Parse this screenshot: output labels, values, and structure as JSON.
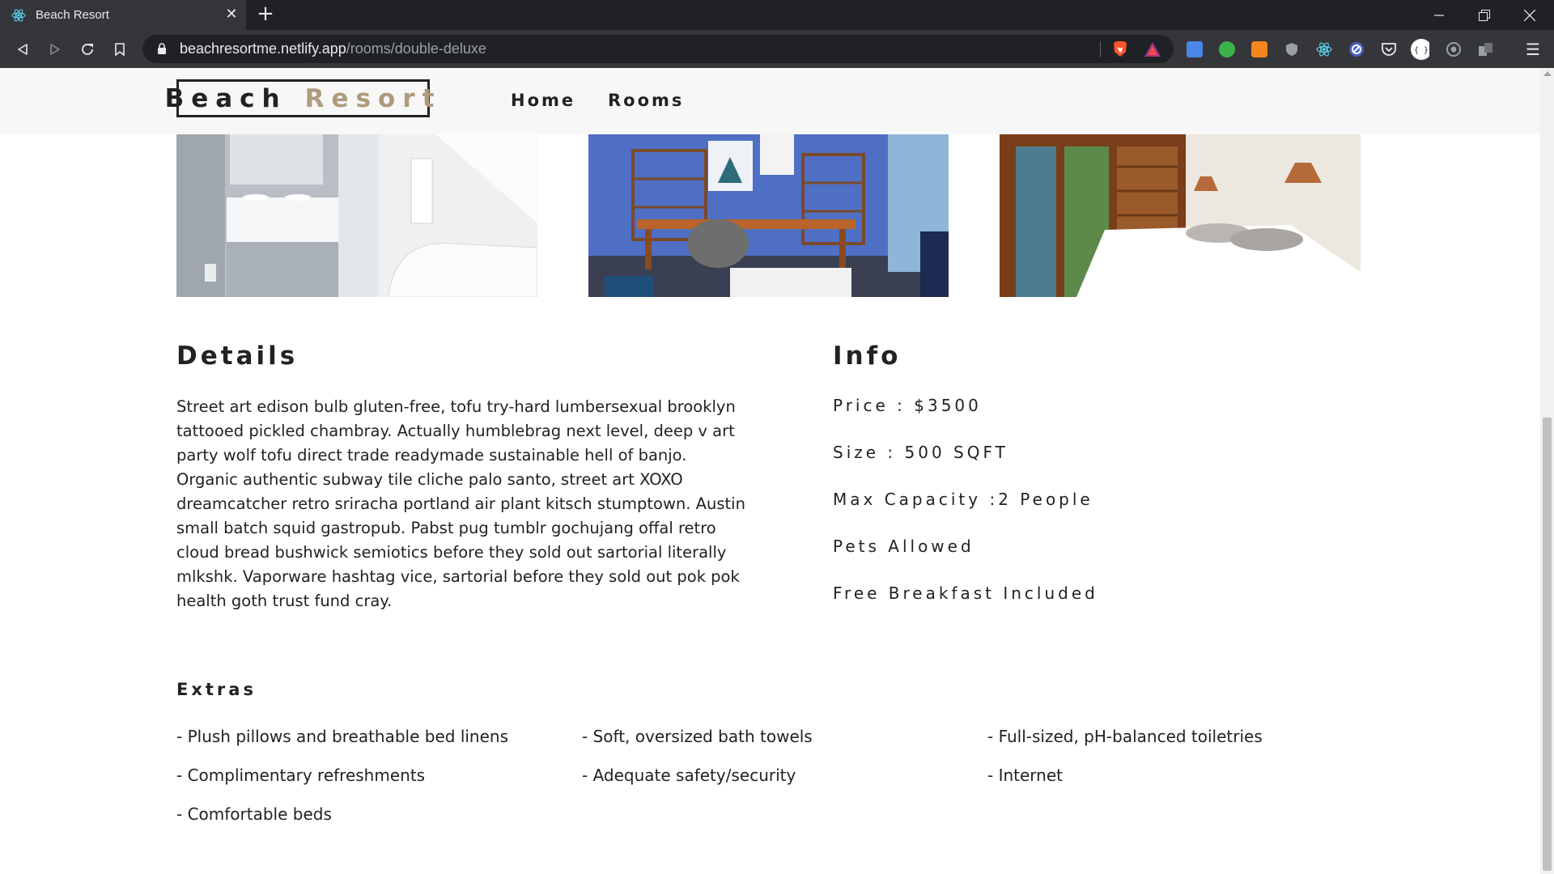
{
  "browser": {
    "tab_title": "Beach Resort",
    "tab_close": "✕",
    "new_tab": "+",
    "url_host": "beachresortme.netlify.app",
    "url_path": "/rooms/double-deluxe",
    "controls": {
      "minimize": "—",
      "restore": "❐",
      "close": "✕"
    },
    "nav": {
      "back": "◁",
      "forward": "▷",
      "reload": "↻",
      "bookmark": "🔖"
    },
    "extensions": [
      "brave-lion-icon",
      "brave-rewards-icon",
      "translate-icon",
      "extension-green-icon",
      "metamask-icon",
      "shield-extension-icon",
      "react-devtools-icon",
      "block-extension-icon",
      "pocket-icon",
      "json-viewer-icon",
      "record-icon",
      "extensions-puzzle-icon"
    ],
    "menu": "☰",
    "colors": {
      "chrome_dark": "#202124",
      "chrome_tab": "#35363a",
      "brave_orange": "#fb542b"
    }
  },
  "site": {
    "logo_part1": "Beach",
    "logo_part2": "Resort",
    "nav_links": [
      "Home",
      "Rooms"
    ],
    "colors": {
      "accent": "#af9a7d",
      "text": "#222222",
      "navbar_bg": "#f7f7f7"
    }
  },
  "images": [
    "bathroom-photo",
    "office-photo",
    "bedroom-photo"
  ],
  "details": {
    "title": "Details",
    "description": "Street art edison bulb gluten-free, tofu try-hard lumbersexual brooklyn tattooed pickled chambray. Actually humblebrag next level, deep v art party wolf tofu direct trade readymade sustainable hell of banjo. Organic authentic subway tile cliche palo santo, street art XOXO dreamcatcher retro sriracha portland air plant kitsch stumptown. Austin small batch squid gastropub. Pabst pug tumblr gochujang offal retro cloud bread bushwick semiotics before they sold out sartorial literally mlkshk. Vaporware hashtag vice, sartorial before they sold out pok pok health goth trust fund cray."
  },
  "info": {
    "title": "Info",
    "price": "Price : $3500",
    "size": "Size : 500 SQFT",
    "capacity": "Max Capacity :2 People",
    "pets": "Pets Allowed",
    "breakfast": "Free Breakfast Included"
  },
  "extras": {
    "title": "Extras",
    "items": [
      "- Plush pillows and breathable bed linens",
      "- Soft, oversized bath towels",
      "- Full-sized, pH-balanced toiletries",
      "- Complimentary refreshments",
      "- Adequate safety/security",
      "- Internet",
      "- Comfortable beds"
    ]
  }
}
